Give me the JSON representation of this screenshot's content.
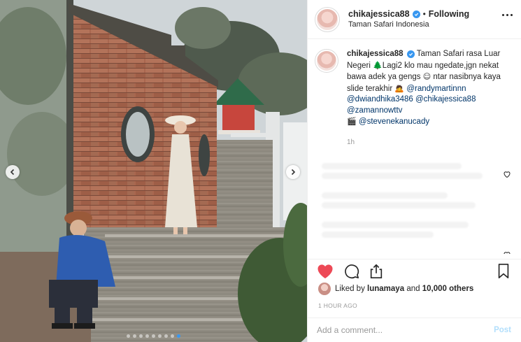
{
  "header": {
    "username": "chikajessica88",
    "separator": "•",
    "follow_status": "Following",
    "location": "Taman Safari Indonesia"
  },
  "caption": {
    "username": "chikajessica88",
    "text_1": "Taman Safari rasa Luar Negeri",
    "emoji_tree": "🌲",
    "text_2": "Lagi2 klo mau ngedate,jgn nekat bawa adek ya gengs",
    "emoji_face": "☺",
    "text_3": "ntar nasibnya kaya slide terakhir",
    "emoji_person": "🙇",
    "mention_1": "@randymartinnn",
    "mention_2": "@dwiandhika3486",
    "mention_3": "@chikajessica88",
    "mention_4": "@zamannowttv",
    "emoji_clapper": "🎬",
    "mention_5": "@stevenekanucady",
    "time": "1h"
  },
  "likes": {
    "prefix": "Liked by",
    "user": "lunamaya",
    "connector": "and",
    "count": "10,000 others"
  },
  "posted": "1 HOUR AGO",
  "comment": {
    "placeholder": "Add a comment...",
    "post_label": "Post"
  },
  "carousel": {
    "slide_count": 9,
    "active_index": 8
  },
  "colors": {
    "like_red": "#ed4956",
    "verified_blue": "#3897f0",
    "mention_blue": "#003569",
    "post_disabled": "#b2dffc"
  },
  "icons": [
    "more-options-icon",
    "verified-badge-icon",
    "heart-icon",
    "comment-icon",
    "share-icon",
    "bookmark-icon",
    "chevron-left-icon",
    "chevron-right-icon"
  ]
}
